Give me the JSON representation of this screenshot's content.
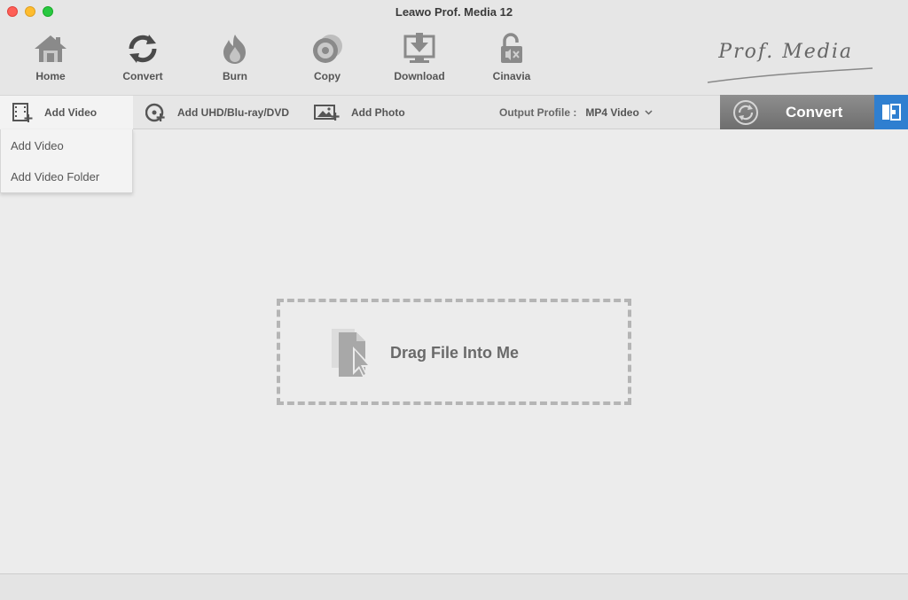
{
  "window": {
    "title": "Leawo Prof. Media 12"
  },
  "toolbar": {
    "items": [
      {
        "label": "Home",
        "icon": "home-icon"
      },
      {
        "label": "Convert",
        "icon": "convert-icon"
      },
      {
        "label": "Burn",
        "icon": "burn-icon"
      },
      {
        "label": "Copy",
        "icon": "copy-disc-icon"
      },
      {
        "label": "Download",
        "icon": "download-icon"
      },
      {
        "label": "Cinavia",
        "icon": "cinavia-lock-icon"
      }
    ],
    "logo_text": "Prof. Media"
  },
  "actions": {
    "add_video": "Add Video",
    "add_uhd": "Add UHD/Blu-ray/DVD",
    "add_photo": "Add Photo",
    "output_profile_label": "Output Profile :",
    "output_profile_value": "MP4 Video"
  },
  "convert_button": {
    "label": "Convert"
  },
  "dropdown": {
    "items": [
      "Add Video",
      "Add Video Folder"
    ]
  },
  "dropzone": {
    "text": "Drag File Into Me"
  },
  "colors": {
    "accent": "#2f7fd0",
    "convert_bg": "#7e7e7e",
    "background": "#ececec"
  }
}
